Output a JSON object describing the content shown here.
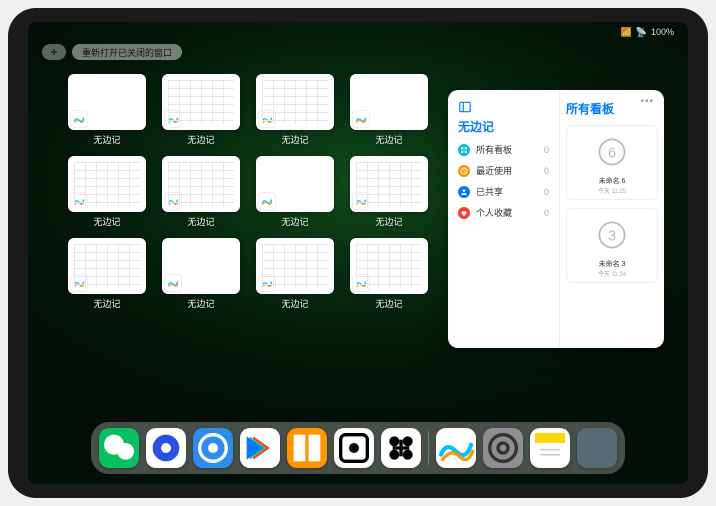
{
  "status": {
    "battery": "100%",
    "wifi": "wifi-icon",
    "signal": "signal-icon"
  },
  "topbar": {
    "new_window": "+",
    "reopen_label": "重新打开已关闭的窗口"
  },
  "windows": [
    {
      "label": "无边记",
      "variant": "blank"
    },
    {
      "label": "无边记",
      "variant": "cal"
    },
    {
      "label": "无边记",
      "variant": "cal"
    },
    {
      "label": "无边记",
      "variant": "blank"
    },
    {
      "label": "无边记",
      "variant": "cal"
    },
    {
      "label": "无边记",
      "variant": "cal"
    },
    {
      "label": "无边记",
      "variant": "blank"
    },
    {
      "label": "无边记",
      "variant": "cal"
    },
    {
      "label": "无边记",
      "variant": "cal"
    },
    {
      "label": "无边记",
      "variant": "blank"
    },
    {
      "label": "无边记",
      "variant": "cal"
    },
    {
      "label": "无边记",
      "variant": "cal"
    }
  ],
  "panel": {
    "left_title": "无边记",
    "right_title": "所有看板",
    "items": [
      {
        "icon": "grid",
        "color": "#00bcd4",
        "label": "所有看板",
        "count": 0
      },
      {
        "icon": "clock",
        "color": "#ff9500",
        "label": "最近使用",
        "count": 0
      },
      {
        "icon": "person",
        "color": "#007aff",
        "label": "已共享",
        "count": 0
      },
      {
        "icon": "heart",
        "color": "#ff3b30",
        "label": "个人收藏",
        "count": 0
      }
    ],
    "boards": [
      {
        "name": "未命名 6",
        "sub": "今天 11:25",
        "glyph": "6"
      },
      {
        "name": "未命名 3",
        "sub": "今天 11:24",
        "glyph": "3"
      }
    ]
  },
  "dock": {
    "apps": [
      {
        "name": "wechat",
        "bg": "#07c160"
      },
      {
        "name": "quark",
        "bg": "#ffffff"
      },
      {
        "name": "qqbrowser",
        "bg": "#2d8cf0"
      },
      {
        "name": "video",
        "bg": "#ffffff"
      },
      {
        "name": "books",
        "bg": "#ff9500"
      },
      {
        "name": "dice",
        "bg": "#ffffff"
      },
      {
        "name": "instant",
        "bg": "#ffffff"
      },
      {
        "name": "freeform",
        "bg": "#ffffff"
      },
      {
        "name": "settings",
        "bg": "#8e8e93"
      },
      {
        "name": "notes",
        "bg": "#ffffff"
      }
    ],
    "folder": "recent-apps"
  }
}
